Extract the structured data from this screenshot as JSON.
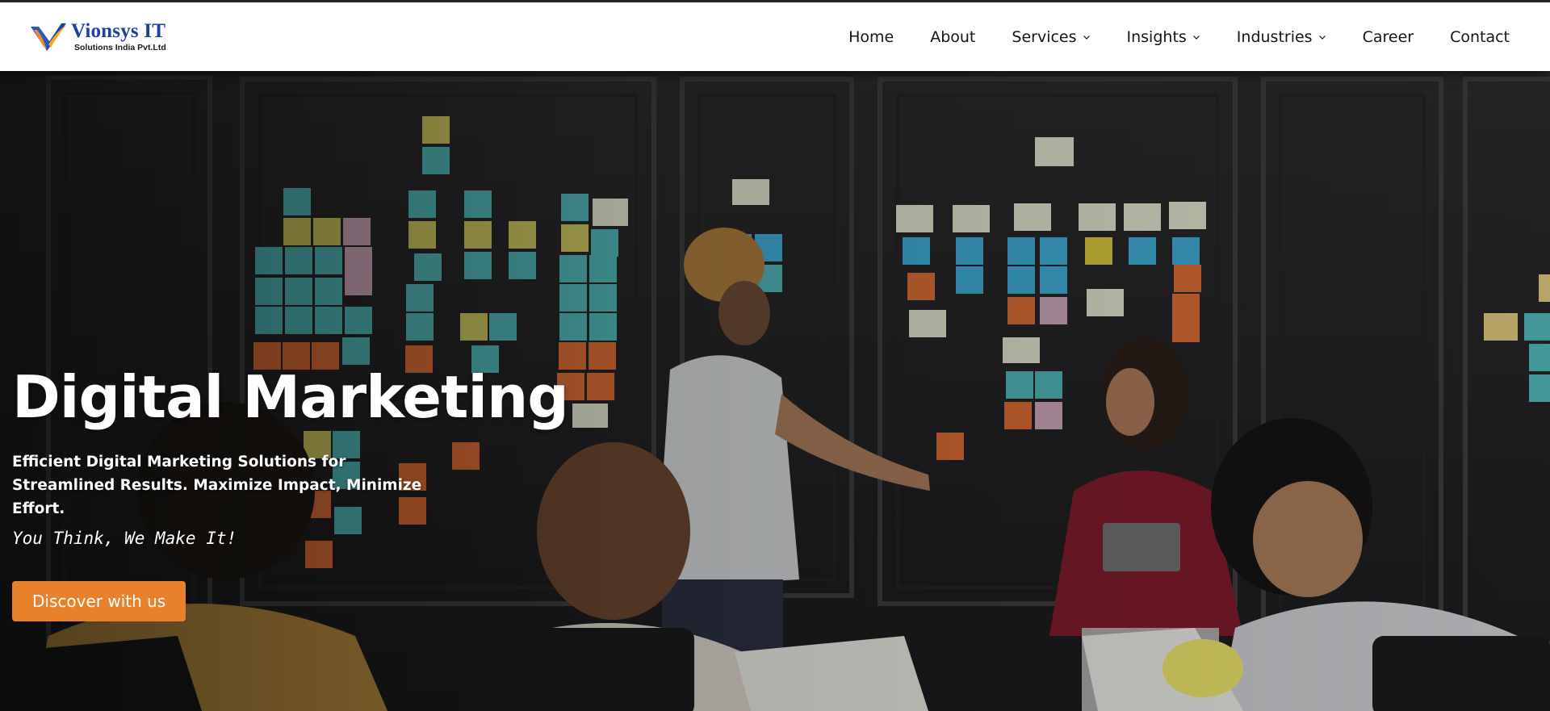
{
  "header": {
    "logo": {
      "name": "Vionsys IT",
      "subtitle": "Solutions India Pvt.Ltd",
      "icon": "v-logo-icon"
    },
    "nav": [
      {
        "label": "Home",
        "dropdown": false
      },
      {
        "label": "About",
        "dropdown": false
      },
      {
        "label": "Services",
        "dropdown": true
      },
      {
        "label": "Insights",
        "dropdown": true
      },
      {
        "label": "Industries",
        "dropdown": true
      },
      {
        "label": "Career",
        "dropdown": false
      },
      {
        "label": "Contact",
        "dropdown": false
      }
    ]
  },
  "hero": {
    "title": "Digital Marketing",
    "subtitle": "Efficient Digital Marketing Solutions for Streamlined Results. Maximize Impact, Minimize Effort.",
    "tagline": "You Think, We Make It!",
    "cta": "Discover with us",
    "background": "team-meeting-sticky-notes-photo"
  },
  "colors": {
    "accent": "#e8812b",
    "brand": "#1e3f9e",
    "header_bg": "#ffffff"
  }
}
